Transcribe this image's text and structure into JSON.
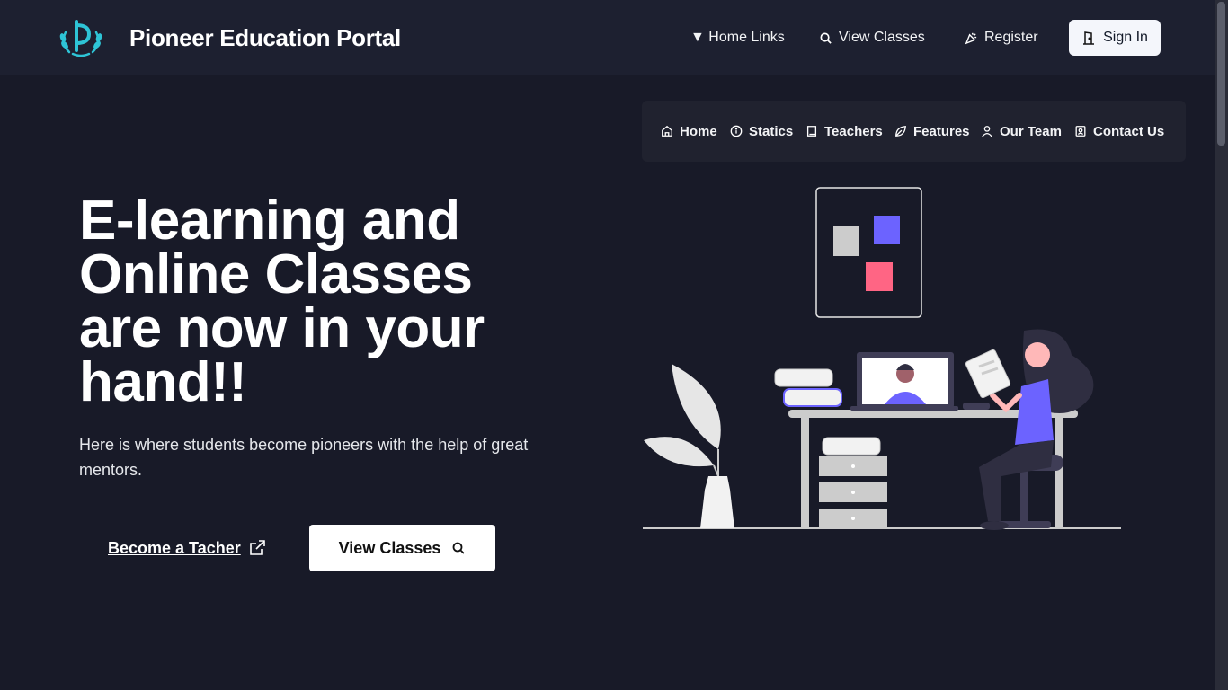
{
  "header": {
    "brand": "Pioneer Education Portal",
    "nav": [
      {
        "label": "▼ Home Links",
        "icon": "none"
      },
      {
        "label": "View Classes",
        "icon": "search-icon"
      },
      {
        "label": "Register",
        "icon": "party-icon"
      }
    ],
    "signin_label": "Sign In"
  },
  "subnav": {
    "items": [
      {
        "label": "Home",
        "icon": "home-icon"
      },
      {
        "label": "Statics",
        "icon": "info-icon"
      },
      {
        "label": "Teachers",
        "icon": "book-icon"
      },
      {
        "label": "Features",
        "icon": "leaf-icon"
      },
      {
        "label": "Our Team",
        "icon": "user-icon"
      },
      {
        "label": "Contact Us",
        "icon": "contact-icon"
      }
    ]
  },
  "hero": {
    "title": "E-learning and Online Classes are now in your hand!!",
    "subtitle": "Here is where students become pioneers with the help of great mentors.",
    "become_label": "Become a Tacher",
    "view_label": "View Classes"
  },
  "colors": {
    "background": "#181a28",
    "header": "#1d2030",
    "accent_purple": "#6c63ff",
    "accent_pink": "#ff6584",
    "logo_teal": "#2dd4bf"
  }
}
